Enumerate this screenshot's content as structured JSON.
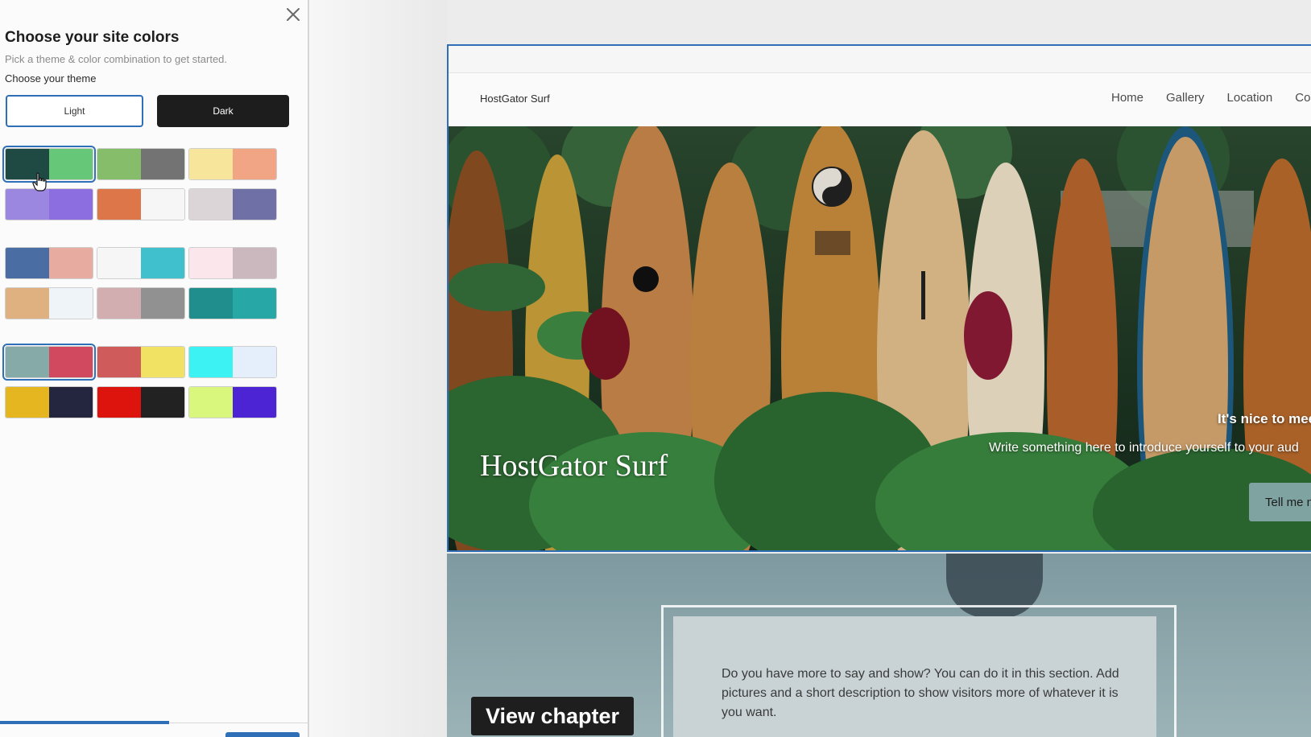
{
  "panel": {
    "title": "Choose your site colors",
    "subtitle": "Pick a theme & color combination to get started.",
    "theme_label": "Choose your theme",
    "themes": {
      "light": "Light",
      "dark": "Dark"
    },
    "selected_theme": "Light",
    "palettes": [
      [
        "#1f4a44",
        "#66c779"
      ],
      [
        "#85bd6b",
        "#737373"
      ],
      [
        "#f6e59b",
        "#f2a585"
      ],
      [
        "#9b86e0",
        "#8c6ee0"
      ],
      [
        "#dd7649",
        "#f6f6f6"
      ],
      [
        "#dcd5d8",
        "#6e70a6"
      ],
      [
        "#4a6ea3",
        "#e7aba0"
      ],
      [
        "#f6f6f6",
        "#3fc0cc"
      ],
      [
        "#fbe6ec",
        "#cbb8bf"
      ],
      [
        "#dfb180",
        "#eef4f7"
      ],
      [
        "#d2aeb1",
        "#919191"
      ],
      [
        "#1f8e8c",
        "#27a7a6"
      ],
      [
        "#86aaa8",
        "#d1495e"
      ],
      [
        "#cf5b5b",
        "#f2e263"
      ],
      [
        "#3df2f2",
        "#e5effc"
      ],
      [
        "#e5b620",
        "#24263f"
      ],
      [
        "#dd140e",
        "#222222"
      ],
      [
        "#d8f77c",
        "#4d24d4"
      ]
    ],
    "selected_palettes": [
      0,
      12
    ],
    "progress": 0.55
  },
  "preview": {
    "site_name": "HostGator Surf",
    "nav": [
      "Home",
      "Gallery",
      "Location",
      "Cor"
    ],
    "hero_title": "HostGator Surf",
    "hero_greeting": "It's nice to mee",
    "hero_intro": "Write something here to introduce yourself to your aud",
    "hero_cta": "Tell me n",
    "section_text": "Do you have more to say and show? You can do it in this section. Add pictures and a short description to show visitors more of whatever it is you want."
  },
  "overlay": {
    "view_chapter": "View chapter"
  },
  "colors": {
    "accent": "#2f6fb7",
    "dark_button": "#1d1d1d",
    "cta": "#7fa3a0"
  },
  "icons": {
    "close": "close-icon",
    "cursor": "hand-cursor-icon"
  }
}
